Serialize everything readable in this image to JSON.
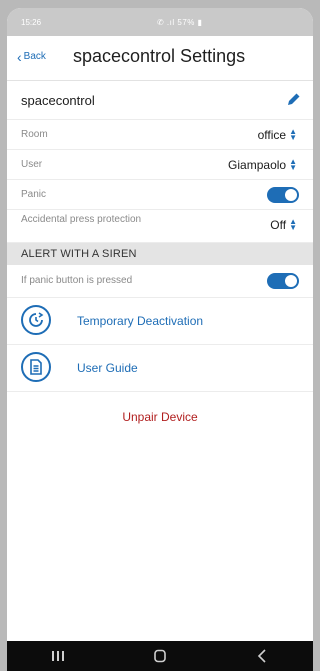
{
  "status_bar": {
    "time": "15:26",
    "icons_text": "✆ .ıl 57% ▮"
  },
  "header": {
    "back_label": "Back",
    "title": "spacecontrol Settings"
  },
  "device": {
    "name": "spacecontrol"
  },
  "fields": {
    "room": {
      "label": "Room",
      "value": "office"
    },
    "user": {
      "label": "User",
      "value": "Giampaolo"
    },
    "panic": {
      "label": "Panic",
      "enabled": true
    },
    "accidental": {
      "label": "Accidental press protection",
      "value": "Off"
    }
  },
  "section": {
    "title": "ALERT WITH A SIREN"
  },
  "siren": {
    "label": "If panic button is pressed",
    "enabled": true
  },
  "actions": {
    "temporary_deactivation": "Temporary Deactivation",
    "user_guide": "User Guide",
    "unpair": "Unpair Device"
  },
  "colors": {
    "accent": "#1e6db6",
    "danger": "#b11f1f",
    "section_bg": "#e4e4e4"
  },
  "icons": {
    "back": "chevron-left-icon",
    "edit": "pencil-icon",
    "deactivation": "timer-deactivate-icon",
    "guide": "document-icon",
    "nav_recents": "recents-icon",
    "nav_home": "home-icon",
    "nav_back": "back-nav-icon"
  }
}
